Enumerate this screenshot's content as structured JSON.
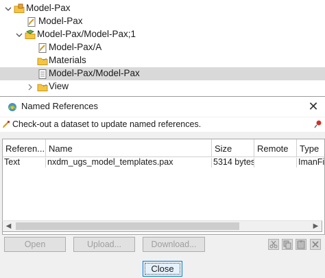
{
  "tree": {
    "items": [
      {
        "label": "Model-Pax",
        "expanded": true,
        "icon": "item-folder-icon"
      },
      {
        "label": "Model-Pax",
        "icon": "revision-doc-icon"
      },
      {
        "label": "Model-Pax/Model-Pax;1",
        "expanded": true,
        "icon": "item-revision-icon"
      },
      {
        "label": "Model-Pax/A",
        "icon": "revision-doc-icon"
      },
      {
        "label": "Materials",
        "icon": "folder-icon"
      },
      {
        "label": "Model-Pax/Model-Pax",
        "icon": "dataset-doc-icon",
        "selected": true
      },
      {
        "label": "View",
        "expanded": false,
        "icon": "folder-icon"
      }
    ]
  },
  "dialog": {
    "title": "Named References",
    "close_glyph": "✕",
    "info_text": "Check-out a dataset to update named references.",
    "columns": [
      "Referen...",
      "Name",
      "Size",
      "Remote",
      "Type"
    ],
    "rows": [
      {
        "ref": "Text",
        "name": "nxdm_ugs_model_templates.pax",
        "size": "5314 bytes",
        "remote": "",
        "type": "ImanFi"
      }
    ],
    "scroll_left": "◀",
    "scroll_right": "▶",
    "buttons": {
      "open": "Open",
      "upload": "Upload...",
      "download": "Download..."
    },
    "tool_icons": [
      "cut-icon",
      "copy-icon",
      "paste-icon",
      "delete-icon"
    ],
    "close_label": "Close"
  },
  "colors": {
    "selection": "#d9d9d9",
    "dialog_bg": "#f0f0f0",
    "focus_border": "#0078d7",
    "disabled_text": "#9e9e9e"
  }
}
